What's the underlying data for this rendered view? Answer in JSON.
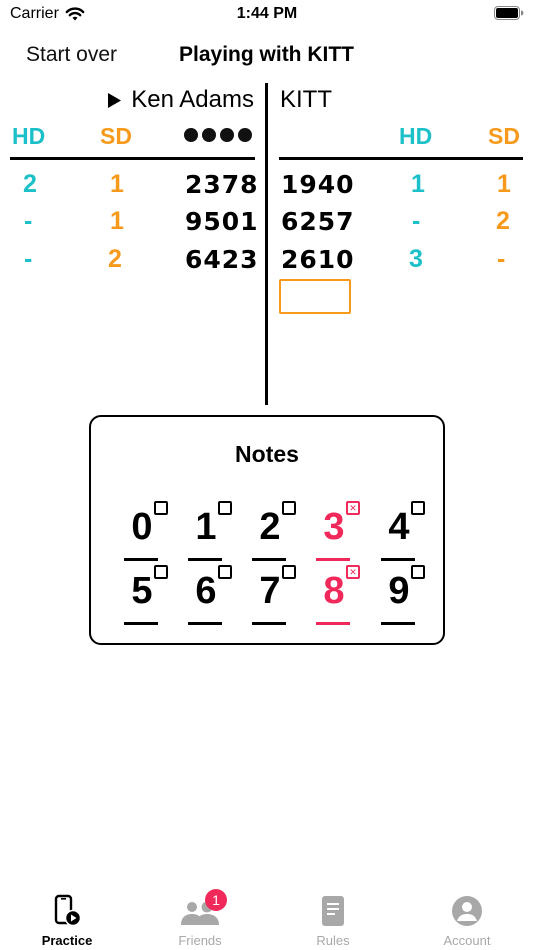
{
  "status_bar": {
    "carrier": "Carrier",
    "time": "1:44 PM"
  },
  "header": {
    "start_over": "Start over",
    "title": "Playing with KITT"
  },
  "board": {
    "left_player": "Ken Adams",
    "right_player": "KITT",
    "hd_label": "HD",
    "sd_label": "SD",
    "left_rows": [
      {
        "hd": "2",
        "sd": "1",
        "guess": "2378"
      },
      {
        "hd": "-",
        "sd": "1",
        "guess": "9501"
      },
      {
        "hd": "-",
        "sd": "2",
        "guess": "6423"
      }
    ],
    "right_rows": [
      {
        "guess": "1940",
        "hd": "1",
        "sd": "1"
      },
      {
        "guess": "6257",
        "hd": "-",
        "sd": "2"
      },
      {
        "guess": "2610",
        "hd": "3",
        "sd": "-"
      }
    ],
    "guess_value": "",
    "colors": {
      "hd": "#1cc0c8",
      "sd": "#f79a1c",
      "crossed": "#f0295a"
    }
  },
  "notes": {
    "title": "Notes",
    "digits": [
      {
        "d": "0",
        "crossed": false
      },
      {
        "d": "1",
        "crossed": false
      },
      {
        "d": "2",
        "crossed": false
      },
      {
        "d": "3",
        "crossed": true
      },
      {
        "d": "4",
        "crossed": false
      },
      {
        "d": "5",
        "crossed": false
      },
      {
        "d": "6",
        "crossed": false
      },
      {
        "d": "7",
        "crossed": false
      },
      {
        "d": "8",
        "crossed": true
      },
      {
        "d": "9",
        "crossed": false
      }
    ]
  },
  "tabs": [
    {
      "label": "Practice",
      "icon": "phone-play-icon",
      "active": true
    },
    {
      "label": "Friends",
      "icon": "friends-icon",
      "badge": "1"
    },
    {
      "label": "Rules",
      "icon": "document-icon"
    },
    {
      "label": "Account",
      "icon": "account-icon"
    }
  ]
}
